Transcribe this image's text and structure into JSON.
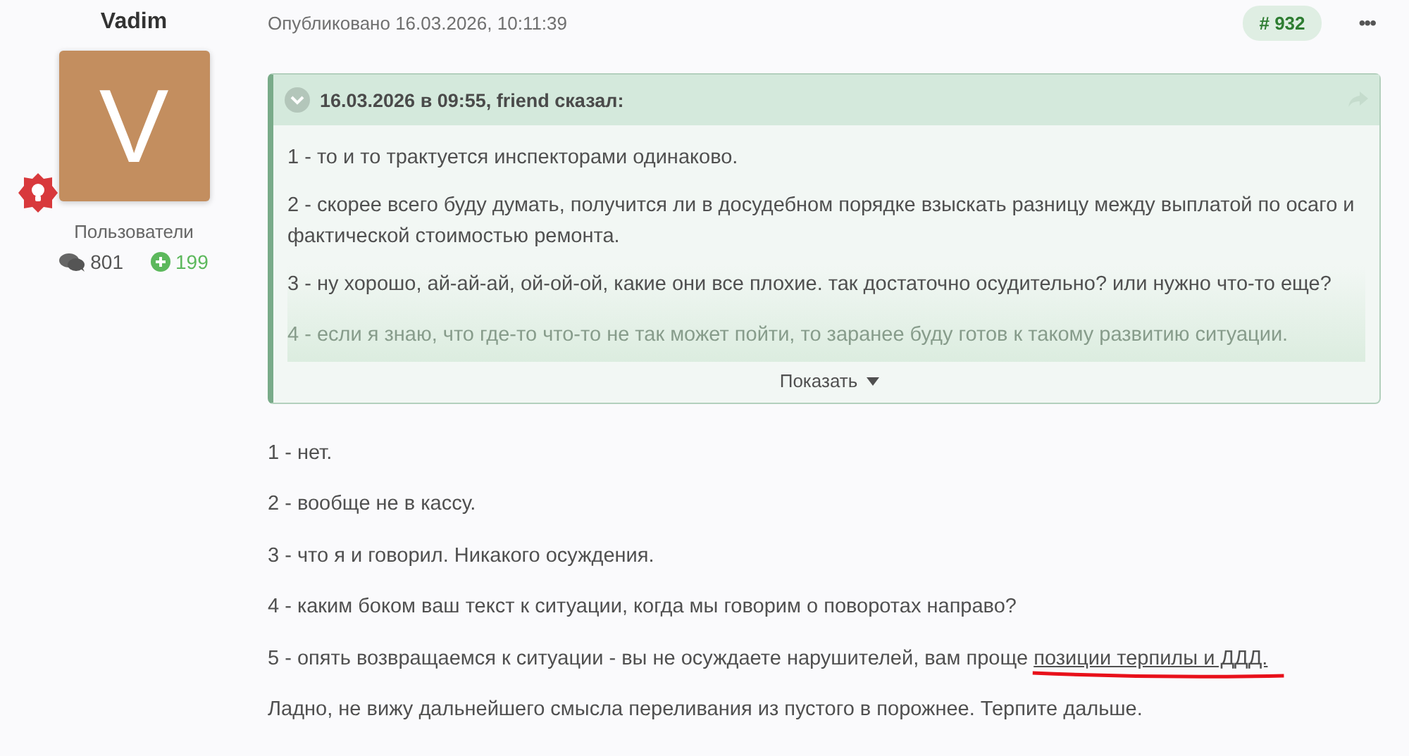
{
  "author": {
    "name": "Vadim",
    "avatar_letter": "V",
    "group": "Пользователи",
    "messages": "801",
    "reactions": "199"
  },
  "post": {
    "published": "Опубликовано 16.03.2026, 10:11:39",
    "number": "# 932",
    "menu": "•••"
  },
  "quote": {
    "header": "16.03.2026 в 09:55, friend сказал:",
    "collapsed": true,
    "expand_label": "Показать",
    "lines": [
      "1 - то и то трактуется инспекторами одинаково.",
      "2 - скорее всего буду думать, получится ли в досудебном порядке взыскать разницу между выплатой по осаго и фактической стоимостью ремонта.",
      "3 - ну хорошо, ай-ай-ай, ой-ой-ой, какие они все плохие. так достаточно осудительно? или нужно что-то еще?",
      "4 - если я знаю, что где-то что-то не так может пойти, то заранее буду готов к такому развитию ситуации."
    ]
  },
  "paragraphs": [
    {
      "text": "1 - нет."
    },
    {
      "text": "2 - вообще не в кассу."
    },
    {
      "text": "3 - что я и говорил. Никакого осуждения."
    },
    {
      "text": "4 - каким боком ваш текст к ситуации, когда мы говорим о поворотах направо?"
    },
    {
      "text": "5 - опять возвращаемся к ситуации - вы не осуждаете нарушителей, вам проще ",
      "link": "позиции терпилы и ДДД.",
      "annotated": true
    },
    {
      "text": "Ладно, не вижу дальнейшего смысла переливания из пустого в порожнее. Терпите дальше."
    }
  ]
}
